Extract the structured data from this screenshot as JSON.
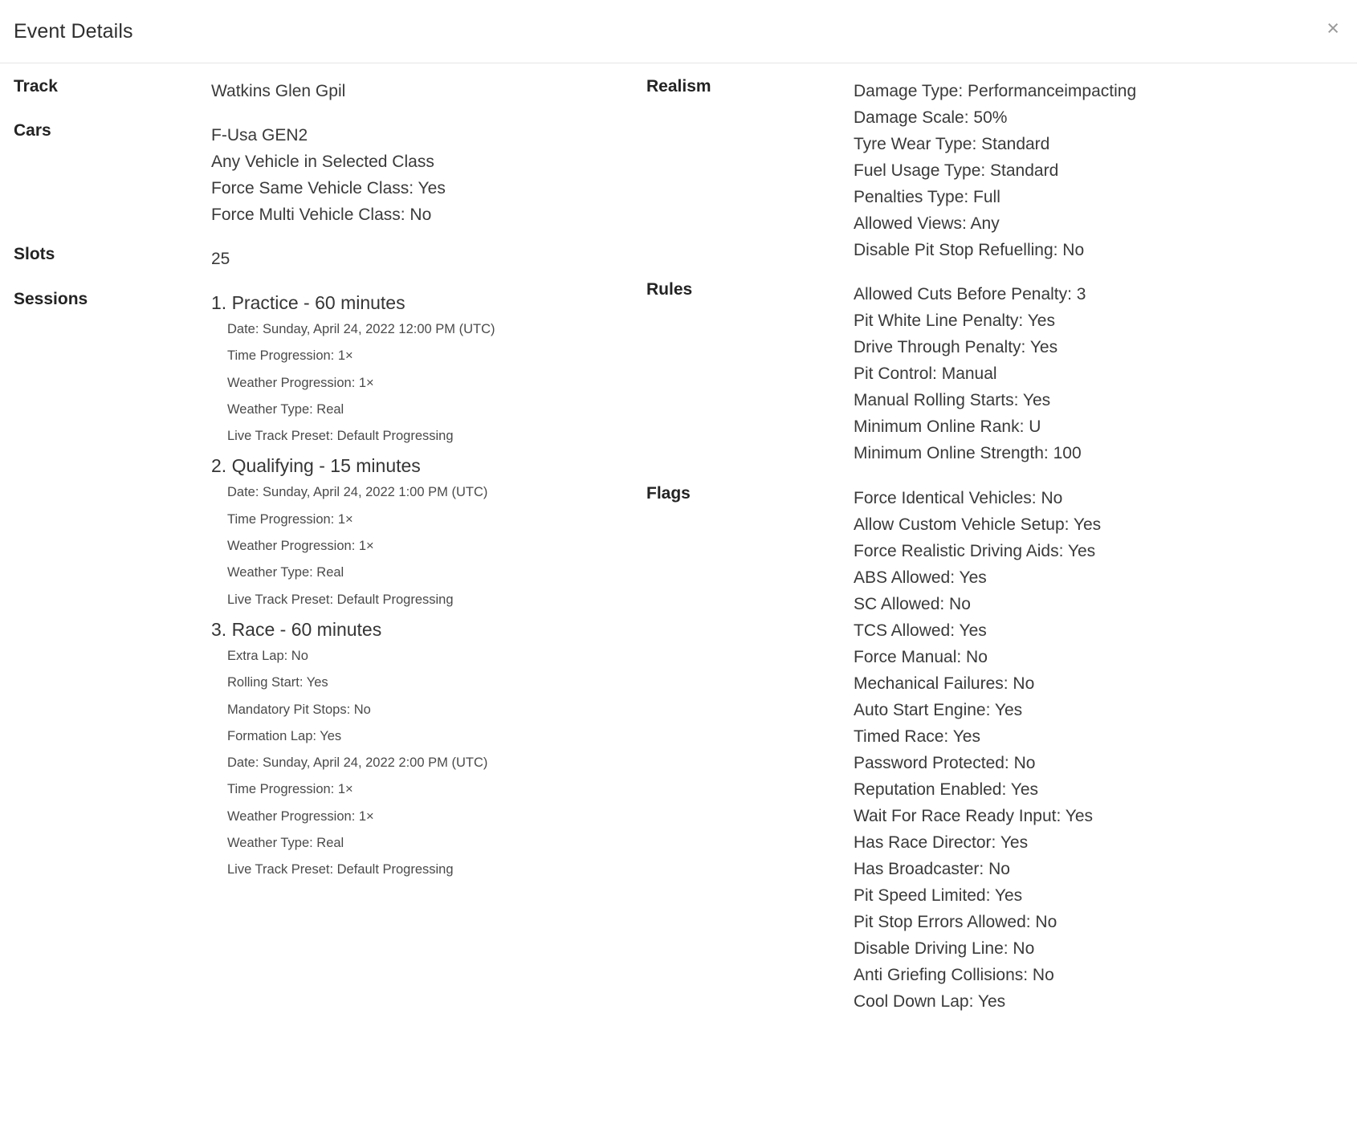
{
  "modal": {
    "title": "Event Details",
    "close_label": "×"
  },
  "left": {
    "track": {
      "label": "Track",
      "values": [
        "Watkins Glen Gpil"
      ]
    },
    "cars": {
      "label": "Cars",
      "values": [
        "F-Usa GEN2",
        "Any Vehicle in Selected Class",
        "Force Same Vehicle Class: Yes",
        "Force Multi Vehicle Class: No"
      ]
    },
    "slots": {
      "label": "Slots",
      "values": [
        "25"
      ]
    },
    "sessions": {
      "label": "Sessions",
      "items": [
        {
          "title": "1. Practice - 60 minutes",
          "details": [
            "Date: Sunday, April 24, 2022 12:00 PM (UTC)",
            "Time Progression: 1×",
            "Weather Progression: 1×",
            "Weather Type: Real",
            "Live Track Preset: Default Progressing"
          ]
        },
        {
          "title": "2. Qualifying - 15 minutes",
          "details": [
            "Date: Sunday, April 24, 2022 1:00 PM (UTC)",
            "Time Progression: 1×",
            "Weather Progression: 1×",
            "Weather Type: Real",
            "Live Track Preset: Default Progressing"
          ]
        },
        {
          "title": "3. Race - 60 minutes",
          "details": [
            "Extra Lap: No",
            "Rolling Start: Yes",
            "Mandatory Pit Stops: No",
            "Formation Lap: Yes",
            "Date: Sunday, April 24, 2022 2:00 PM (UTC)",
            "Time Progression: 1×",
            "Weather Progression: 1×",
            "Weather Type: Real",
            "Live Track Preset: Default Progressing"
          ]
        }
      ]
    }
  },
  "right": {
    "realism": {
      "label": "Realism",
      "values": [
        "Damage Type: Performanceimpacting",
        "Damage Scale: 50%",
        "Tyre Wear Type: Standard",
        "Fuel Usage Type: Standard",
        "Penalties Type: Full",
        "Allowed Views: Any",
        "Disable Pit Stop Refuelling: No"
      ]
    },
    "rules": {
      "label": "Rules",
      "values": [
        "Allowed Cuts Before Penalty: 3",
        "Pit White Line Penalty: Yes",
        "Drive Through Penalty: Yes",
        "Pit Control: Manual",
        "Manual Rolling Starts: Yes",
        "Minimum Online Rank: U",
        "Minimum Online Strength: 100"
      ]
    },
    "flags": {
      "label": "Flags",
      "values": [
        "Force Identical Vehicles: No",
        "Allow Custom Vehicle Setup: Yes",
        "Force Realistic Driving Aids: Yes",
        "ABS Allowed: Yes",
        "SC Allowed: No",
        "TCS Allowed: Yes",
        "Force Manual: No",
        "Mechanical Failures: No",
        "Auto Start Engine: Yes",
        "Timed Race: Yes",
        "Password Protected: No",
        "Reputation Enabled: Yes",
        "Wait For Race Ready Input: Yes",
        "Has Race Director: Yes",
        "Has Broadcaster: No",
        "Pit Speed Limited: Yes",
        "Pit Stop Errors Allowed: No",
        "Disable Driving Line: No",
        "Anti Griefing Collisions: No",
        "Cool Down Lap: Yes"
      ]
    }
  }
}
